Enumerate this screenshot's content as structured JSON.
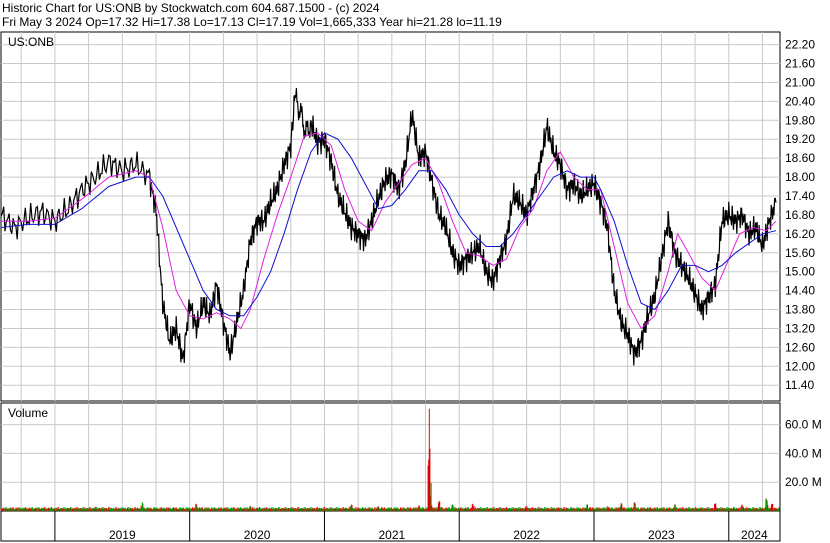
{
  "header": {
    "line1": "Historic Chart for US:ONB by Stockwatch.com 604.687.1500 - (c) 2024",
    "line2": "Fri May  3 2024  Op=17.32  Hi=17.38  Lo=17.13  Cl=17.19  Vol=1,665,333  Year hi=21.28  lo=11.19"
  },
  "colors": {
    "price": "#000000",
    "ma_short": "#e020e0",
    "ma_long": "#1010d0",
    "volume_up": "#00a000",
    "volume_down": "#e00000",
    "grid": "#c8c8c8"
  },
  "chart_data": [
    {
      "type": "line",
      "label": "US:ONB",
      "y_ticks": [
        "22.20",
        "21.60",
        "21.00",
        "20.40",
        "19.80",
        "19.20",
        "18.60",
        "18.00",
        "17.40",
        "16.80",
        "16.20",
        "15.60",
        "15.00",
        "14.40",
        "13.80",
        "13.20",
        "12.60",
        "12.00",
        "11.40"
      ],
      "ylim": [
        10.9,
        22.6
      ],
      "x_ticks": [
        "2019",
        "2020",
        "2021",
        "2022",
        "2023",
        "2024"
      ],
      "x_range": [
        2018.6,
        2024.38
      ],
      "series": [
        {
          "role": "price",
          "points": [
            [
              2018.6,
              16.8
            ],
            [
              2018.7,
              16.4
            ],
            [
              2018.8,
              16.7
            ],
            [
              2018.9,
              16.9
            ],
            [
              2019.0,
              16.6
            ],
            [
              2019.1,
              17.0
            ],
            [
              2019.2,
              17.6
            ],
            [
              2019.3,
              18.0
            ],
            [
              2019.4,
              18.5
            ],
            [
              2019.5,
              18.2
            ],
            [
              2019.6,
              18.4
            ],
            [
              2019.7,
              18.0
            ],
            [
              2019.75,
              17.0
            ],
            [
              2019.8,
              14.0
            ],
            [
              2019.85,
              12.8
            ],
            [
              2019.9,
              13.2
            ],
            [
              2019.95,
              12.2
            ],
            [
              2020.0,
              14.0
            ],
            [
              2020.05,
              13.2
            ],
            [
              2020.1,
              14.0
            ],
            [
              2020.15,
              13.6
            ],
            [
              2020.2,
              14.6
            ],
            [
              2020.25,
              13.4
            ],
            [
              2020.3,
              12.4
            ],
            [
              2020.35,
              13.4
            ],
            [
              2020.4,
              14.4
            ],
            [
              2020.45,
              16.0
            ],
            [
              2020.5,
              16.6
            ],
            [
              2020.55,
              16.6
            ],
            [
              2020.6,
              17.2
            ],
            [
              2020.65,
              17.6
            ],
            [
              2020.7,
              18.4
            ],
            [
              2020.75,
              19.0
            ],
            [
              2020.78,
              20.5
            ],
            [
              2020.82,
              20.1
            ],
            [
              2020.86,
              19.4
            ],
            [
              2020.9,
              19.7
            ],
            [
              2020.95,
              19.1
            ],
            [
              2021.0,
              19.2
            ],
            [
              2021.05,
              18.5
            ],
            [
              2021.1,
              17.4
            ],
            [
              2021.15,
              16.9
            ],
            [
              2021.2,
              16.4
            ],
            [
              2021.25,
              16.2
            ],
            [
              2021.3,
              16.0
            ],
            [
              2021.35,
              16.6
            ],
            [
              2021.4,
              17.3
            ],
            [
              2021.45,
              17.9
            ],
            [
              2021.5,
              18.1
            ],
            [
              2021.55,
              17.6
            ],
            [
              2021.6,
              18.4
            ],
            [
              2021.65,
              20.0
            ],
            [
              2021.7,
              18.6
            ],
            [
              2021.75,
              18.8
            ],
            [
              2021.8,
              17.8
            ],
            [
              2021.85,
              16.8
            ],
            [
              2021.9,
              16.4
            ],
            [
              2021.95,
              15.6
            ],
            [
              2022.0,
              15.2
            ],
            [
              2022.05,
              15.4
            ],
            [
              2022.1,
              15.6
            ],
            [
              2022.15,
              15.8
            ],
            [
              2022.2,
              15.0
            ],
            [
              2022.25,
              14.7
            ],
            [
              2022.3,
              15.4
            ],
            [
              2022.35,
              16.0
            ],
            [
              2022.4,
              17.4
            ],
            [
              2022.45,
              17.2
            ],
            [
              2022.5,
              16.8
            ],
            [
              2022.55,
              17.6
            ],
            [
              2022.6,
              18.4
            ],
            [
              2022.65,
              19.6
            ],
            [
              2022.7,
              18.8
            ],
            [
              2022.75,
              18.4
            ],
            [
              2022.8,
              17.6
            ],
            [
              2022.85,
              17.8
            ],
            [
              2022.9,
              17.4
            ],
            [
              2022.95,
              17.6
            ],
            [
              2023.0,
              17.8
            ],
            [
              2023.05,
              17.2
            ],
            [
              2023.1,
              16.4
            ],
            [
              2023.15,
              14.4
            ],
            [
              2023.2,
              13.4
            ],
            [
              2023.25,
              13.0
            ],
            [
              2023.3,
              12.4
            ],
            [
              2023.35,
              12.8
            ],
            [
              2023.4,
              13.6
            ],
            [
              2023.45,
              14.2
            ],
            [
              2023.5,
              15.4
            ],
            [
              2023.55,
              16.6
            ],
            [
              2023.6,
              15.6
            ],
            [
              2023.65,
              15.2
            ],
            [
              2023.7,
              14.8
            ],
            [
              2023.75,
              14.3
            ],
            [
              2023.8,
              13.8
            ],
            [
              2023.85,
              14.2
            ],
            [
              2023.9,
              14.6
            ],
            [
              2023.95,
              16.6
            ],
            [
              2024.0,
              16.8
            ],
            [
              2024.05,
              16.6
            ],
            [
              2024.1,
              16.8
            ],
            [
              2024.15,
              16.2
            ],
            [
              2024.2,
              16.4
            ],
            [
              2024.25,
              15.8
            ],
            [
              2024.3,
              16.6
            ],
            [
              2024.35,
              17.19
            ]
          ]
        },
        {
          "role": "ma_short",
          "points": [
            [
              2018.6,
              16.6
            ],
            [
              2018.8,
              16.6
            ],
            [
              2019.0,
              16.7
            ],
            [
              2019.2,
              17.3
            ],
            [
              2019.4,
              18.0
            ],
            [
              2019.6,
              18.2
            ],
            [
              2019.7,
              18.0
            ],
            [
              2019.8,
              16.4
            ],
            [
              2019.9,
              14.4
            ],
            [
              2020.0,
              13.6
            ],
            [
              2020.1,
              13.5
            ],
            [
              2020.2,
              13.7
            ],
            [
              2020.3,
              13.5
            ],
            [
              2020.38,
              13.2
            ],
            [
              2020.45,
              13.8
            ],
            [
              2020.55,
              15.4
            ],
            [
              2020.65,
              16.8
            ],
            [
              2020.75,
              18.0
            ],
            [
              2020.85,
              19.3
            ],
            [
              2020.95,
              19.4
            ],
            [
              2021.05,
              19.0
            ],
            [
              2021.15,
              17.6
            ],
            [
              2021.25,
              16.6
            ],
            [
              2021.35,
              16.3
            ],
            [
              2021.45,
              17.2
            ],
            [
              2021.55,
              17.8
            ],
            [
              2021.65,
              18.4
            ],
            [
              2021.75,
              18.6
            ],
            [
              2021.85,
              17.8
            ],
            [
              2021.95,
              16.6
            ],
            [
              2022.05,
              15.6
            ],
            [
              2022.15,
              15.5
            ],
            [
              2022.25,
              15.2
            ],
            [
              2022.35,
              15.4
            ],
            [
              2022.45,
              16.4
            ],
            [
              2022.55,
              17.0
            ],
            [
              2022.65,
              18.2
            ],
            [
              2022.75,
              18.8
            ],
            [
              2022.85,
              18.0
            ],
            [
              2022.95,
              17.6
            ],
            [
              2023.05,
              17.6
            ],
            [
              2023.15,
              15.8
            ],
            [
              2023.25,
              14.0
            ],
            [
              2023.35,
              13.2
            ],
            [
              2023.45,
              13.6
            ],
            [
              2023.55,
              15.0
            ],
            [
              2023.62,
              16.2
            ],
            [
              2023.7,
              15.6
            ],
            [
              2023.8,
              14.8
            ],
            [
              2023.9,
              14.4
            ],
            [
              2023.98,
              15.2
            ],
            [
              2024.08,
              16.2
            ],
            [
              2024.18,
              16.4
            ],
            [
              2024.28,
              16.3
            ],
            [
              2024.35,
              16.6
            ]
          ]
        },
        {
          "role": "ma_long",
          "points": [
            [
              2018.6,
              16.4
            ],
            [
              2018.8,
              16.5
            ],
            [
              2019.0,
              16.5
            ],
            [
              2019.2,
              17.0
            ],
            [
              2019.4,
              17.7
            ],
            [
              2019.6,
              18.0
            ],
            [
              2019.7,
              18.0
            ],
            [
              2019.8,
              17.4
            ],
            [
              2019.9,
              16.4
            ],
            [
              2020.0,
              15.4
            ],
            [
              2020.1,
              14.4
            ],
            [
              2020.2,
              13.8
            ],
            [
              2020.3,
              13.6
            ],
            [
              2020.4,
              13.6
            ],
            [
              2020.5,
              14.2
            ],
            [
              2020.6,
              15.0
            ],
            [
              2020.7,
              16.2
            ],
            [
              2020.8,
              17.6
            ],
            [
              2020.9,
              18.8
            ],
            [
              2021.0,
              19.4
            ],
            [
              2021.1,
              19.2
            ],
            [
              2021.2,
              18.6
            ],
            [
              2021.3,
              17.8
            ],
            [
              2021.4,
              17.0
            ],
            [
              2021.5,
              17.1
            ],
            [
              2021.6,
              17.6
            ],
            [
              2021.7,
              18.2
            ],
            [
              2021.8,
              18.2
            ],
            [
              2021.9,
              17.6
            ],
            [
              2022.0,
              16.8
            ],
            [
              2022.1,
              16.2
            ],
            [
              2022.2,
              15.8
            ],
            [
              2022.3,
              15.8
            ],
            [
              2022.4,
              16.2
            ],
            [
              2022.5,
              16.8
            ],
            [
              2022.6,
              17.4
            ],
            [
              2022.7,
              18.0
            ],
            [
              2022.8,
              18.2
            ],
            [
              2022.9,
              18.0
            ],
            [
              2023.0,
              18.0
            ],
            [
              2023.05,
              17.6
            ],
            [
              2023.15,
              16.6
            ],
            [
              2023.25,
              15.2
            ],
            [
              2023.35,
              14.0
            ],
            [
              2023.45,
              13.8
            ],
            [
              2023.55,
              14.4
            ],
            [
              2023.65,
              15.2
            ],
            [
              2023.75,
              15.2
            ],
            [
              2023.85,
              15.0
            ],
            [
              2023.95,
              15.2
            ],
            [
              2024.05,
              15.6
            ],
            [
              2024.15,
              15.9
            ],
            [
              2024.25,
              16.2
            ],
            [
              2024.35,
              16.3
            ]
          ]
        }
      ]
    },
    {
      "type": "bar",
      "label": "Volume",
      "y_ticks": [
        "60.0 M",
        "40.0 M",
        "20.0 M"
      ],
      "ylim": [
        0,
        75
      ],
      "x_ticks": [
        "2019",
        "2020",
        "2021",
        "2022",
        "2023",
        "2024"
      ],
      "x_range": [
        2018.6,
        2024.38
      ],
      "peaks": [
        [
          2019.3,
          3.0,
          "down"
        ],
        [
          2019.65,
          6.0,
          "up"
        ],
        [
          2020.05,
          5.0,
          "down"
        ],
        [
          2020.45,
          3.5,
          "down"
        ],
        [
          2021.2,
          4.5,
          "up"
        ],
        [
          2021.4,
          3.2,
          "down"
        ],
        [
          2021.7,
          4.0,
          "down"
        ],
        [
          2021.78,
          71.0,
          "down"
        ],
        [
          2021.785,
          10.0,
          "down"
        ],
        [
          2021.85,
          7.0,
          "down"
        ],
        [
          2021.95,
          4.5,
          "up"
        ],
        [
          2022.1,
          5.0,
          "down"
        ],
        [
          2022.5,
          3.5,
          "down"
        ],
        [
          2022.95,
          4.5,
          "down"
        ],
        [
          2023.1,
          3.5,
          "up"
        ],
        [
          2023.2,
          5.5,
          "down"
        ],
        [
          2023.3,
          6.0,
          "down"
        ],
        [
          2023.6,
          4.5,
          "up"
        ],
        [
          2023.9,
          5.0,
          "down"
        ],
        [
          2024.1,
          4.5,
          "down"
        ],
        [
          2024.28,
          8.0,
          "up"
        ],
        [
          2024.32,
          5.0,
          "down"
        ]
      ]
    }
  ]
}
